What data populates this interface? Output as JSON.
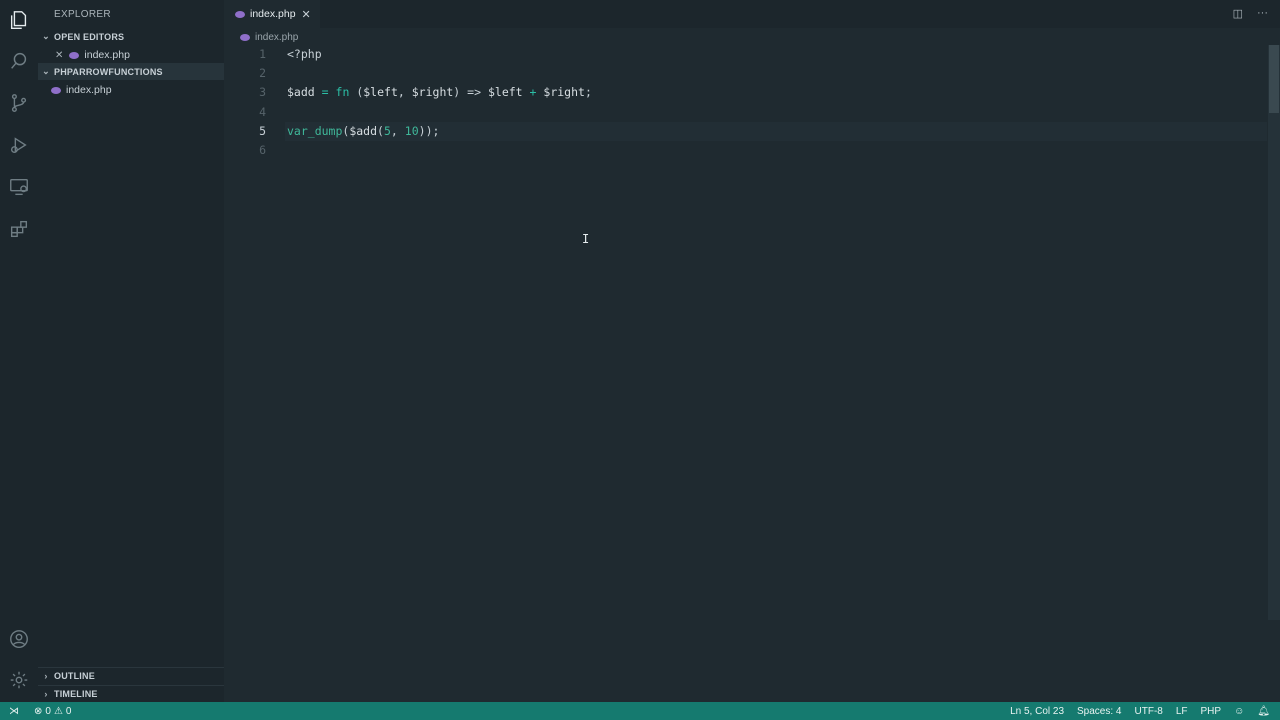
{
  "sidebar": {
    "title": "EXPLORER",
    "open_editors": {
      "heading": "OPEN EDITORS",
      "files": [
        {
          "name": "index.php"
        }
      ]
    },
    "folder": {
      "heading": "PHPARROWFUNCTIONS",
      "files": [
        {
          "name": "index.php"
        }
      ]
    },
    "outline": "OUTLINE",
    "timeline": "TIMELINE"
  },
  "editor": {
    "tab": {
      "label": "index.php"
    },
    "breadcrumb": "index.php",
    "line_numbers": [
      "1",
      "2",
      "3",
      "4",
      "5",
      "6"
    ],
    "current_line": 5
  },
  "code": {
    "l1": "<?php",
    "l3": {
      "var_add": "$add",
      "eq": "=",
      "fn": "fn",
      "open": "(",
      "left": "$left",
      "comma": ",",
      "right": "$right",
      "close": ")",
      "arrow": "=>",
      "left2": "$left",
      "plus": "+",
      "right2": "$right",
      "semi": ";"
    },
    "l5": {
      "func": "var_dump",
      "open": "(",
      "var_add": "$add",
      "open2": "(",
      "n1": "5",
      "comma": ",",
      "n2": "10",
      "close": "));"
    }
  },
  "statusbar": {
    "errors": "0",
    "warnings": "0",
    "position": "Ln 5, Col 23",
    "spaces": "Spaces: 4",
    "encoding": "UTF-8",
    "eol": "LF",
    "language": "PHP"
  },
  "colors": {
    "accent_status": "#157a6f",
    "php_icon": "#8f6fc9",
    "keyword": "#2bbfa6"
  }
}
